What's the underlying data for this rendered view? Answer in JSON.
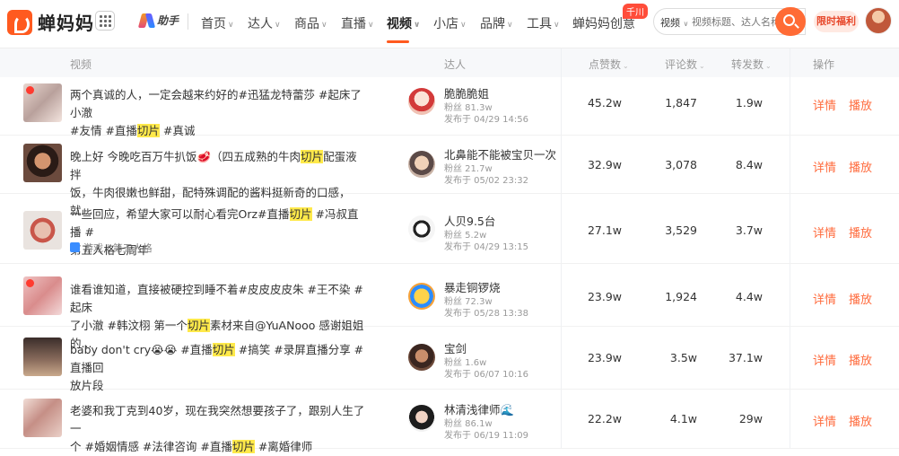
{
  "app": {
    "logo_text": "蝉妈妈",
    "assistant_label": "助手"
  },
  "nav": {
    "items": [
      {
        "label": "首页",
        "caret": "∨"
      },
      {
        "label": "达人",
        "caret": "∨"
      },
      {
        "label": "商品",
        "caret": "∨"
      },
      {
        "label": "直播",
        "caret": "∨"
      },
      {
        "label": "视频",
        "caret": "∨"
      },
      {
        "label": "小店",
        "caret": "∨"
      },
      {
        "label": "品牌",
        "caret": "∨"
      },
      {
        "label": "工具",
        "caret": "∨"
      },
      {
        "label": "蝉妈妈创意",
        "caret": ""
      }
    ],
    "active": "视频",
    "badge": "千川"
  },
  "search": {
    "type_label": "视频",
    "type_caret": "∨",
    "placeholder": "视频标题、达人名称"
  },
  "promo_label": "限时福利",
  "table": {
    "headers": {
      "video": "视频",
      "creator": "达人",
      "likes": "点赞数",
      "comments": "评论数",
      "shares": "转发数",
      "actions": "操作",
      "sort_glyph": "⌄"
    },
    "action_detail": "详情",
    "action_play": "播放",
    "rows": [
      {
        "title_line1_pre": "两个真诚的人，一定会越来约好的#迅猛龙特蕾莎 #起床了小澈",
        "title_line1_hl": "",
        "title_line1_post": "",
        "title_line2_pre": "#友情 #直播",
        "title_line2_hl": "切片",
        "title_line2_post": " #真诚",
        "tag": "",
        "creator_name": "脆脆脆姐",
        "followers": "粉丝 81.3w",
        "published": "发布于 04/29 14:56",
        "likes": "45.2w",
        "comments": "1,847",
        "shares": "1.9w"
      },
      {
        "title_line1_pre": "晚上好 今晚吃百万牛扒饭🥩（四五成熟的牛肉",
        "title_line1_hl": "切片",
        "title_line1_post": "配蛋液拌",
        "title_line2_pre": "饭，牛肉很嫩也鲜甜，配特殊调配的酱料挺新奇的口感，就...",
        "title_line2_hl": "",
        "title_line2_post": "",
        "tag": "",
        "creator_name": "北鼻能不能被宝贝一次",
        "followers": "粉丝 21.7w",
        "published": "发布于 05/02 23:32",
        "likes": "32.9w",
        "comments": "3,078",
        "shares": "8.4w"
      },
      {
        "title_line1_pre": "一些回应，希望大家可以耐心看完Orz#直播",
        "title_line1_hl": "切片",
        "title_line1_post": " #冯叔直播 #",
        "title_line2_pre": "第五人格七周年",
        "title_line2_hl": "",
        "title_line2_post": "",
        "tag": "游戏 | 第五人格",
        "creator_name": "人贝9.5台",
        "followers": "粉丝 5.2w",
        "published": "发布于 04/29 13:15",
        "likes": "27.1w",
        "comments": "3,529",
        "shares": "3.7w"
      },
      {
        "title_line1_pre": "谁看谁知道，直接被硬控到睡不着#皮皮皮皮朱 #王不染 #起床",
        "title_line1_hl": "",
        "title_line1_post": "",
        "title_line2_pre": "了小澈 #韩汶栩 第一个",
        "title_line2_hl": "切片",
        "title_line2_post": "素材来自@YuANooo 感谢姐姐的...",
        "tag": "",
        "creator_name": "暴走铜锣烧",
        "followers": "粉丝 72.3w",
        "published": "发布于 05/28 13:38",
        "likes": "23.9w",
        "comments": "1,924",
        "shares": "4.4w"
      },
      {
        "title_line1_pre": "baby don't cry😭😭 #直播",
        "title_line1_hl": "切片",
        "title_line1_post": " #搞笑 #录屏直播分享 #直播回",
        "title_line2_pre": "放片段",
        "title_line2_hl": "",
        "title_line2_post": "",
        "tag": "",
        "creator_name": "宝剑",
        "followers": "粉丝 1.6w",
        "published": "发布于 06/07 10:16",
        "likes": "23.9w",
        "comments": "3.5w",
        "shares": "37.1w"
      },
      {
        "title_line1_pre": "老婆和我丁克到40岁，现在我突然想要孩子了，跟别人生了一",
        "title_line1_hl": "",
        "title_line1_post": "",
        "title_line2_pre": "个 #婚姻情感 #法律咨询 #直播",
        "title_line2_hl": "切片",
        "title_line2_post": " #离婚律师",
        "tag": "",
        "creator_name": "林清浅律师🌊",
        "followers": "粉丝 86.1w",
        "published": "发布于 06/19 11:09",
        "likes": "22.2w",
        "comments": "4.1w",
        "shares": "29w"
      }
    ]
  },
  "colors": {
    "accent": "#ff5a1f",
    "action": "#ff6b3d",
    "highlight": "#ffe94a"
  }
}
